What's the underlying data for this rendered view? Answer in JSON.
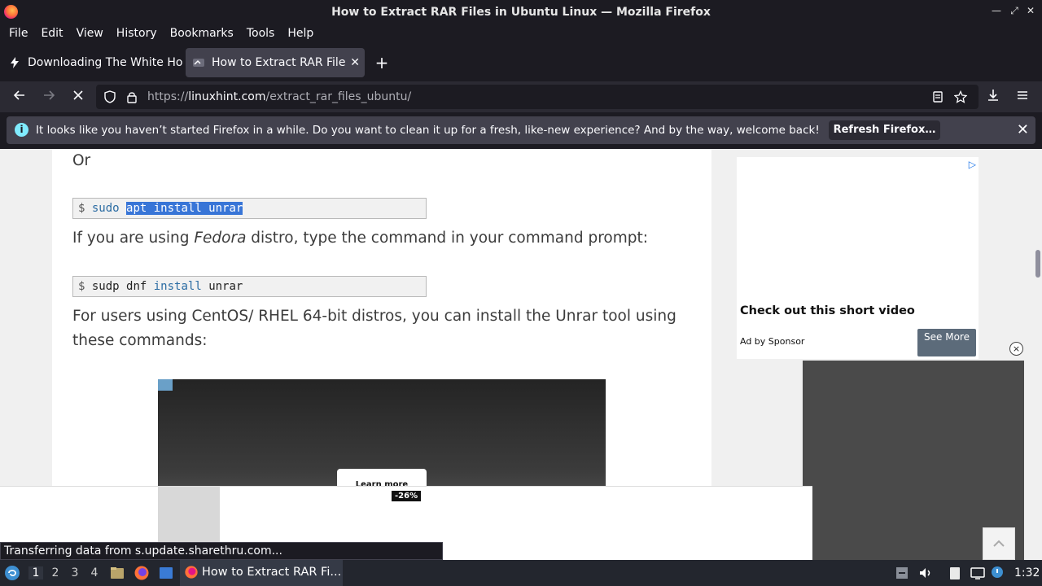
{
  "window": {
    "title": "How to Extract RAR Files in Ubuntu Linux — Mozilla Firefox",
    "controls": [
      "—",
      "⤢",
      "✕"
    ]
  },
  "menu": [
    "File",
    "Edit",
    "View",
    "History",
    "Bookmarks",
    "Tools",
    "Help"
  ],
  "tabs": [
    {
      "label": "Downloading The White House",
      "active": false
    },
    {
      "label": "How to Extract RAR Files",
      "active": true
    }
  ],
  "navbar": {
    "url_prefix": "https://",
    "url_host": "linuxhint.com",
    "url_path": "/extract_rar_files_ubuntu/"
  },
  "notification": {
    "message": "It looks like you haven’t started Firefox in a while. Do you want to clean it up for a fresh, like-new experience? And by the way, welcome back!",
    "button": "Refresh Firefox…"
  },
  "article": {
    "or": "Or",
    "code1": {
      "prompt": "$",
      "cmd": "sudo",
      "selected": "apt install unrar"
    },
    "fedora_pre": "If you are using ",
    "fedora_em": "Fedora",
    "fedora_post": " distro, type the command in your command prompt:",
    "code2": {
      "prompt": "$",
      "cmd": "sudp dnf",
      "kw": "install",
      "arg": "unrar"
    },
    "centos_line1": "For users using CentOS/ RHEL 64-bit distros, you can install the Unrar tool using",
    "centos_line2": "these commands:",
    "video_button": "Learn more"
  },
  "sidebar_ad": {
    "title": "Check out this short video",
    "sponsor": "Ad by Sponsor",
    "button": "See More",
    "close": "×"
  },
  "bottom_ad": {
    "badge": "-26%"
  },
  "status": "Transferring data from s.update.sharethru.com...",
  "taskbar": {
    "workspaces": [
      "1",
      "2",
      "3",
      "4"
    ],
    "active_workspace": "1",
    "task_label": "How to Extract RAR Fi...",
    "clock": "1:32"
  }
}
